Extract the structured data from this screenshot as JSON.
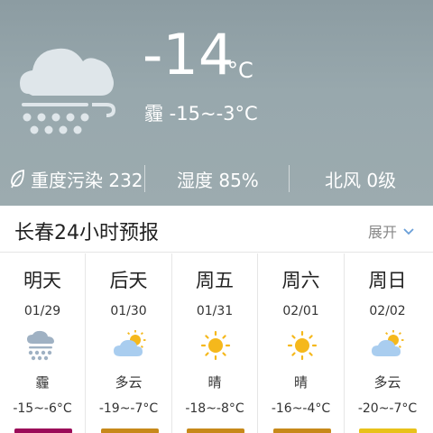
{
  "current": {
    "temperature": "-14",
    "unit": "°C",
    "description": "霾 -15~-3°C",
    "icon": "haze-night-icon"
  },
  "stats": {
    "pollution": "重度污染 232",
    "humidity": "湿度 85%",
    "wind": "北风 0级"
  },
  "forecast_header": {
    "title": "长春24小时预报",
    "expand_label": "展开"
  },
  "forecast": [
    {
      "day": "明天",
      "date": "01/29",
      "condition": "霾",
      "range": "-15~-6°C",
      "icon": "haze-icon",
      "aqi_color": "#9b0b59"
    },
    {
      "day": "后天",
      "date": "01/30",
      "condition": "多云",
      "range": "-19~-7°C",
      "icon": "partly-cloudy-icon",
      "aqi_color": "#c7891a"
    },
    {
      "day": "周五",
      "date": "01/31",
      "condition": "晴",
      "range": "-18~-8°C",
      "icon": "sunny-icon",
      "aqi_color": "#c7891a"
    },
    {
      "day": "周六",
      "date": "02/01",
      "condition": "晴",
      "range": "-16~-4°C",
      "icon": "sunny-icon",
      "aqi_color": "#c7891a"
    },
    {
      "day": "周日",
      "date": "02/02",
      "condition": "多云",
      "range": "-20~-7°C",
      "icon": "partly-cloudy-icon",
      "aqi_color": "#e8c21a"
    }
  ]
}
